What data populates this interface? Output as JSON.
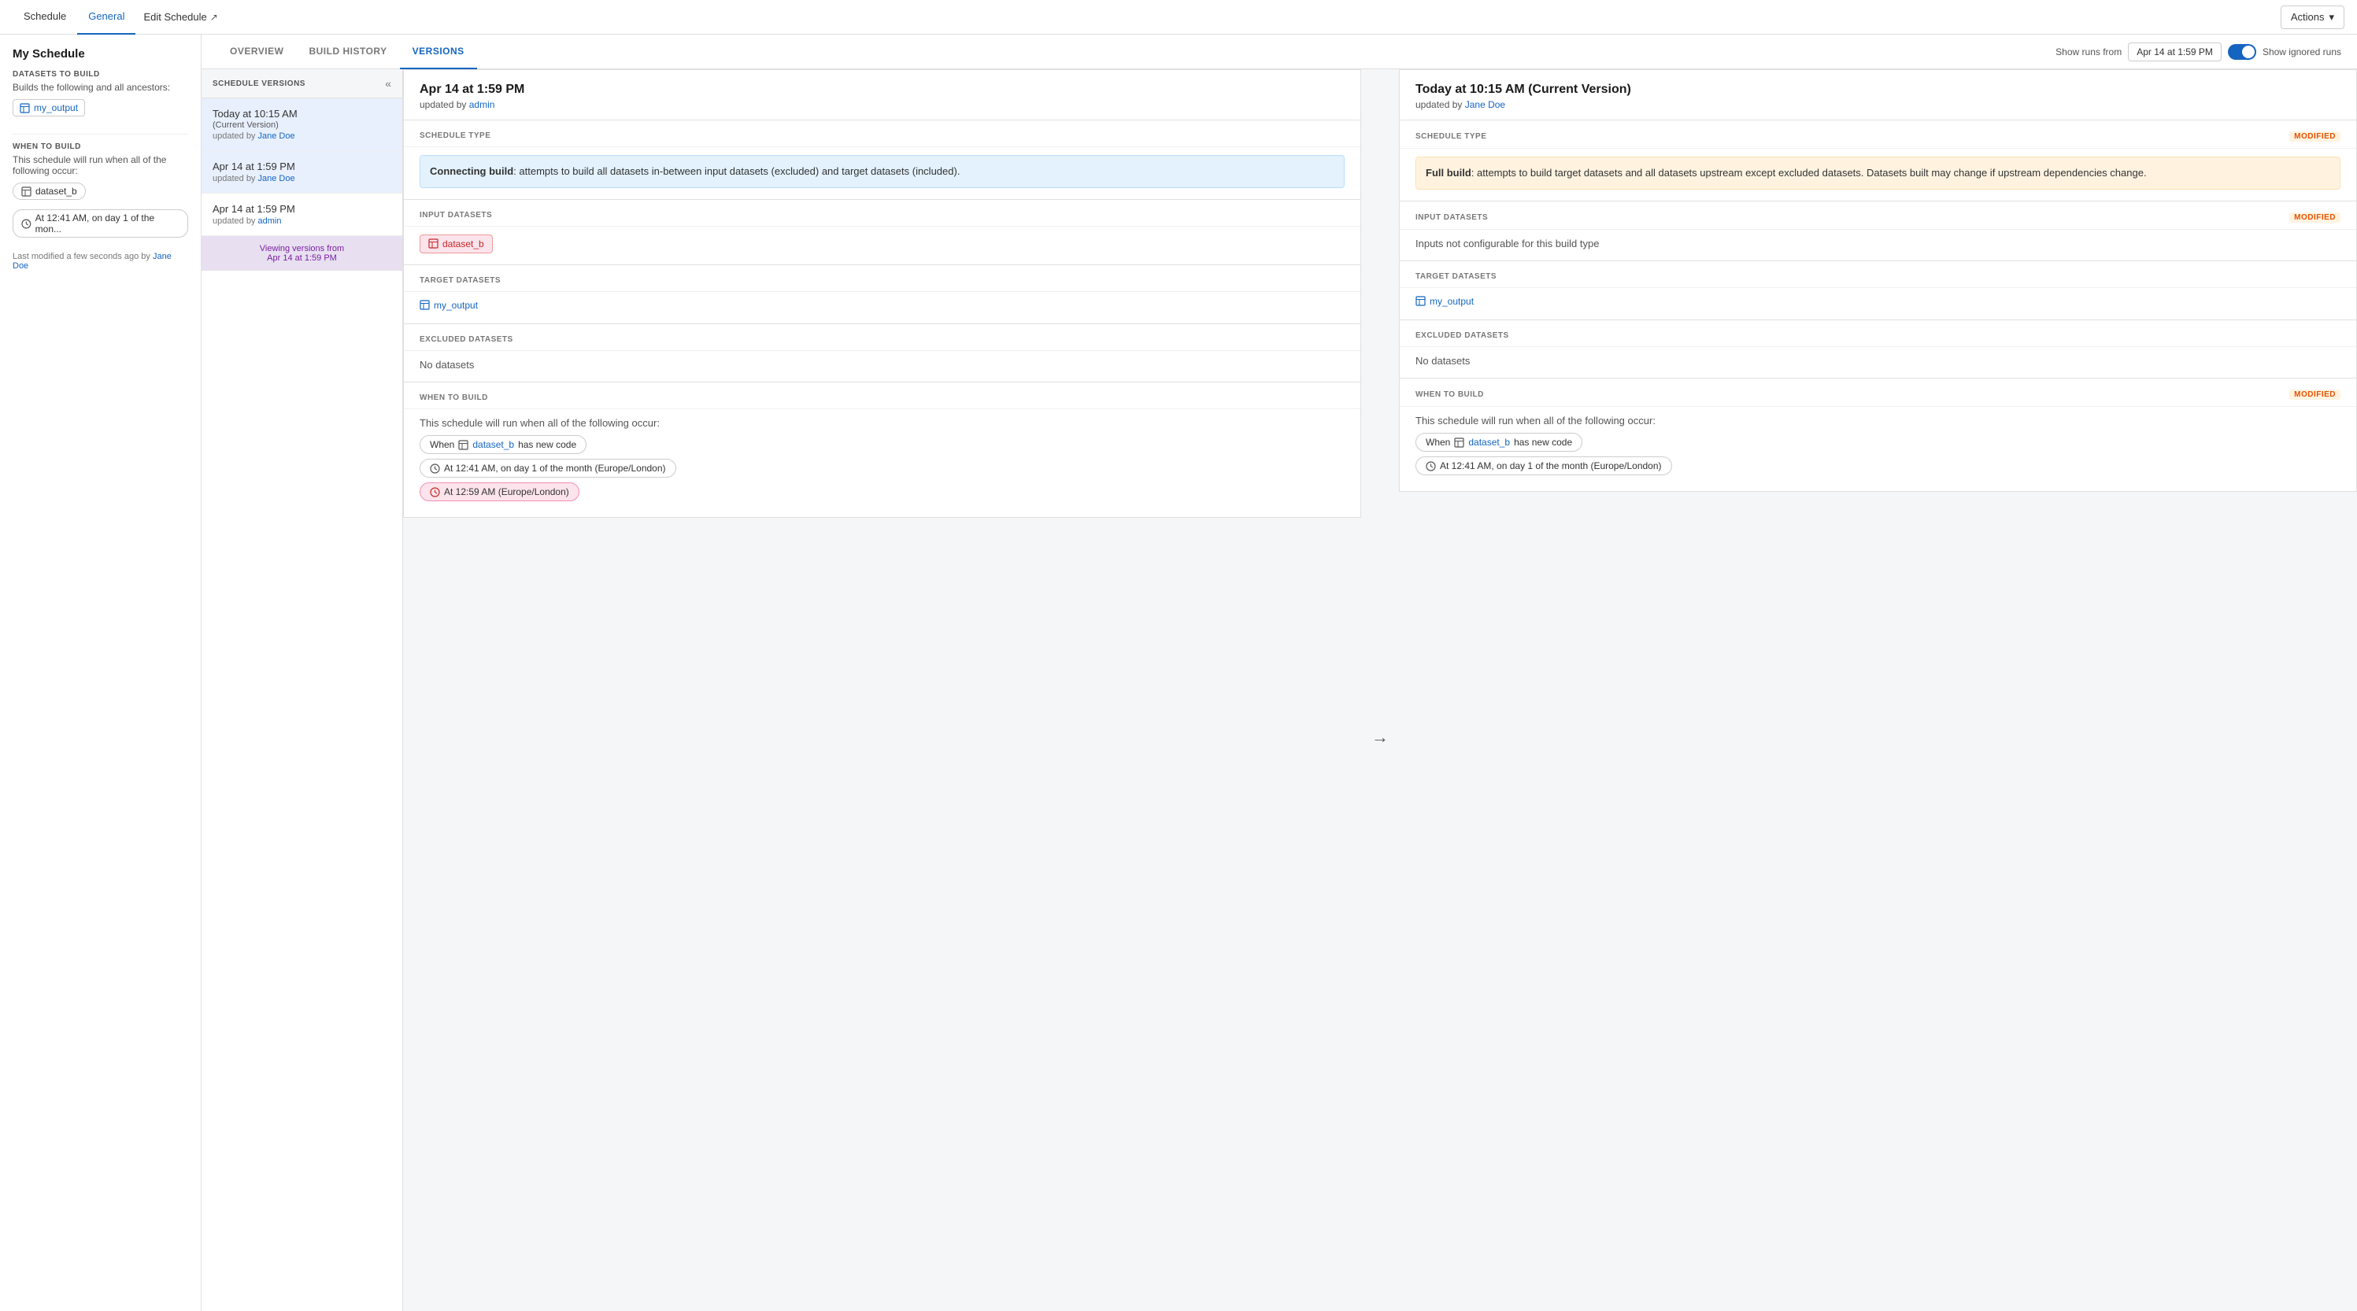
{
  "topNav": {
    "tab1": "Schedule",
    "tab2": "General",
    "tab3": "Edit Schedule",
    "editArrow": "↗",
    "actionsBtn": "Actions",
    "actionsChevron": "▾"
  },
  "sidebar": {
    "title": "My Schedule",
    "datasetsToBuild": "DATASETS TO BUILD",
    "datasetsToBuildDesc": "Builds the following and all ancestors:",
    "outputDataset": "my_output",
    "whenToBuild": "WHEN TO BUILD",
    "whenToBuildDesc": "This schedule will run when all of the following occur:",
    "condition1": "dataset_b",
    "condition2": "At 12:41 AM, on day 1 of the mon...",
    "lastModified": "Last modified a few seconds ago by",
    "lastModifiedBy": "Jane Doe"
  },
  "tabs": {
    "overview": "OVERVIEW",
    "buildHistory": "BUILD HISTORY",
    "versions": "VERSIONS"
  },
  "controls": {
    "showRunsFrom": "Show runs from",
    "dateValue": "Apr 14 at 1:59 PM",
    "showIgnoredRuns": "Show ignored runs"
  },
  "versionsPanel": {
    "title": "SCHEDULE VERSIONS",
    "collapseIcon": "«",
    "versions": [
      {
        "date": "Today at 10:15 AM",
        "sub": "(Current Version)",
        "updatedBy": "Jane Doe",
        "selected": true
      },
      {
        "date": "Apr 14 at 1:59 PM",
        "sub": "",
        "updatedBy": "Jane Doe",
        "selected": false
      },
      {
        "date": "Apr 14 at 1:59 PM",
        "sub": "",
        "updatedBy": "admin",
        "selected": false
      }
    ],
    "viewingFrom": "Viewing versions from",
    "viewingFromDate": "Apr 14 at 1:59 PM"
  },
  "leftVersion": {
    "date": "Apr 14 at 1:59 PM",
    "updatedBy": "admin",
    "scheduleTypeLabel": "SCHEDULE TYPE",
    "scheduleTypeText": "Connecting build",
    "scheduleTypeDesc": ": attempts to build all datasets in-between input datasets (excluded) and target datasets (included).",
    "inputDatasetsLabel": "INPUT DATASETS",
    "inputDataset": "dataset_b",
    "targetDatasetsLabel": "TARGET DATASETS",
    "targetDataset": "my_output",
    "excludedDatasetsLabel": "EXCLUDED DATASETS",
    "excludedDatasetsValue": "No datasets",
    "whenToBuildLabel": "WHEN TO BUILD",
    "whenToBuildDesc": "This schedule will run when all of the following occur:",
    "conditions": [
      {
        "text": "When",
        "dataset": "dataset_b",
        "suffix": "has new code"
      },
      {
        "text": "At 12:41 AM, on day 1 of the month (Europe/London)"
      },
      {
        "text": "At 12:59 AM (Europe/London)",
        "pink": true
      }
    ]
  },
  "rightVersion": {
    "date": "Today at 10:15 AM (Current Version)",
    "updatedBy": "Jane Doe",
    "scheduleTypeLabel": "SCHEDULE TYPE",
    "scheduleTypeModified": "Modified",
    "scheduleTypeText": "Full build",
    "scheduleTypeDesc": ": attempts to build target datasets and all datasets upstream except excluded datasets. Datasets built may change if upstream dependencies change.",
    "inputDatasetsLabel": "INPUT DATASETS",
    "inputDatasetsModified": "Modified",
    "inputDatasetsValue": "Inputs not configurable for this build type",
    "targetDatasetsLabel": "TARGET DATASETS",
    "targetDataset": "my_output",
    "excludedDatasetsLabel": "EXCLUDED DATASETS",
    "excludedDatasetsValue": "No datasets",
    "whenToBuildLabel": "WHEN TO BUILD",
    "whenToBuildModified": "Modified",
    "whenToBuildDesc": "This schedule will run when all of the following occur:",
    "conditions": [
      {
        "text": "When",
        "dataset": "dataset_b",
        "suffix": "has new code"
      },
      {
        "text": "At 12:41 AM, on day 1 of the month (Europe/London)"
      }
    ]
  }
}
